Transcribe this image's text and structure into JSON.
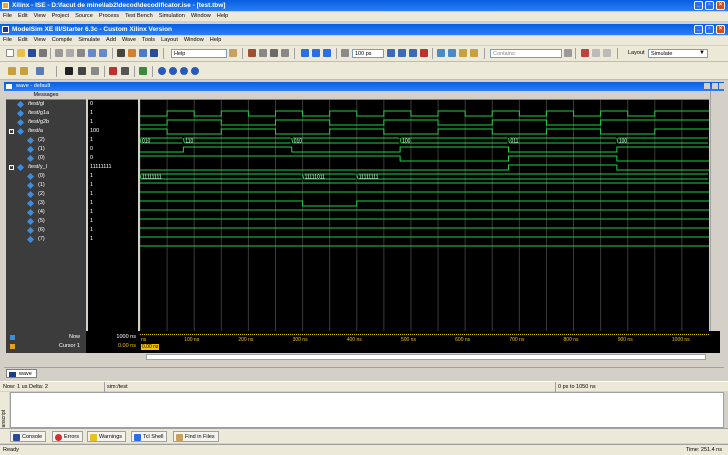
{
  "xilinx": {
    "title": "Xilinx - ISE - D:\\facut de mine\\lab2\\decod\\decodificator.ise - [test.tbw]",
    "menu": [
      "File",
      "Edit",
      "View",
      "Project",
      "Source",
      "Process",
      "Test Bench",
      "Simulation",
      "Window",
      "Help"
    ]
  },
  "modelsim": {
    "title": "ModelSim XE III/Starter 6.3c - Custom Xilinx Version",
    "menu": [
      "File",
      "Edit",
      "View",
      "Compile",
      "Simulate",
      "Add",
      "Wave",
      "Tools",
      "Layout",
      "Window",
      "Help"
    ],
    "help_field": "Help",
    "run_length": "100 ps",
    "contains_placeholder": "Contains:",
    "layout_label": "Layout",
    "layout_value": "Simulate"
  },
  "wave": {
    "window_title": "wave - default",
    "messages_header": "Messages",
    "signals": [
      {
        "name": "/test/gl",
        "value": "0",
        "indent": 0,
        "expand": ""
      },
      {
        "name": "/test/g1a",
        "value": "1",
        "indent": 0,
        "expand": ""
      },
      {
        "name": "/test/g2b",
        "value": "1",
        "indent": 0,
        "expand": ""
      },
      {
        "name": "/test/a",
        "value": "100",
        "indent": 0,
        "expand": "-"
      },
      {
        "name": "(2)",
        "value": "1",
        "indent": 1,
        "expand": ""
      },
      {
        "name": "(1)",
        "value": "0",
        "indent": 1,
        "expand": ""
      },
      {
        "name": "(0)",
        "value": "0",
        "indent": 1,
        "expand": ""
      },
      {
        "name": "/test/y_l",
        "value": "11111111",
        "indent": 0,
        "expand": "-"
      },
      {
        "name": "(0)",
        "value": "1",
        "indent": 1,
        "expand": ""
      },
      {
        "name": "(1)",
        "value": "1",
        "indent": 1,
        "expand": ""
      },
      {
        "name": "(2)",
        "value": "1",
        "indent": 1,
        "expand": ""
      },
      {
        "name": "(3)",
        "value": "1",
        "indent": 1,
        "expand": ""
      },
      {
        "name": "(4)",
        "value": "1",
        "indent": 1,
        "expand": ""
      },
      {
        "name": "(5)",
        "value": "1",
        "indent": 1,
        "expand": ""
      },
      {
        "name": "(6)",
        "value": "1",
        "indent": 1,
        "expand": ""
      },
      {
        "name": "(7)",
        "value": "1",
        "indent": 1,
        "expand": ""
      }
    ],
    "bus_a_labels": [
      "010",
      "110",
      "010",
      "100",
      "011",
      "100"
    ],
    "bus_y_labels": [
      "11111111",
      "11111011",
      "11111111"
    ],
    "now_label": "Now",
    "now_value": "1000 ns",
    "cursor_label": "Cursor 1",
    "cursor_value": "0.00 ns",
    "cursor_box": "0.00 ns",
    "time_ticks": [
      "ns",
      "100 ns",
      "200 ns",
      "300 ns",
      "400 ns",
      "500 ns",
      "600 ns",
      "700 ns",
      "800 ns",
      "900 ns",
      "1000 ns"
    ],
    "tab": "wave"
  },
  "status": {
    "now_delta": "Now: 1 us  Delta: 2",
    "path": "sim:/test",
    "range": "0 ps to 1050 ns"
  },
  "bottom_tabs": [
    "Console",
    "Errors",
    "Warnings",
    "Tcl Shell",
    "Find in Files"
  ],
  "transcript_label": "Transcript",
  "ise_status": {
    "left": "Ready",
    "right": "Time: 251.4 ns"
  }
}
